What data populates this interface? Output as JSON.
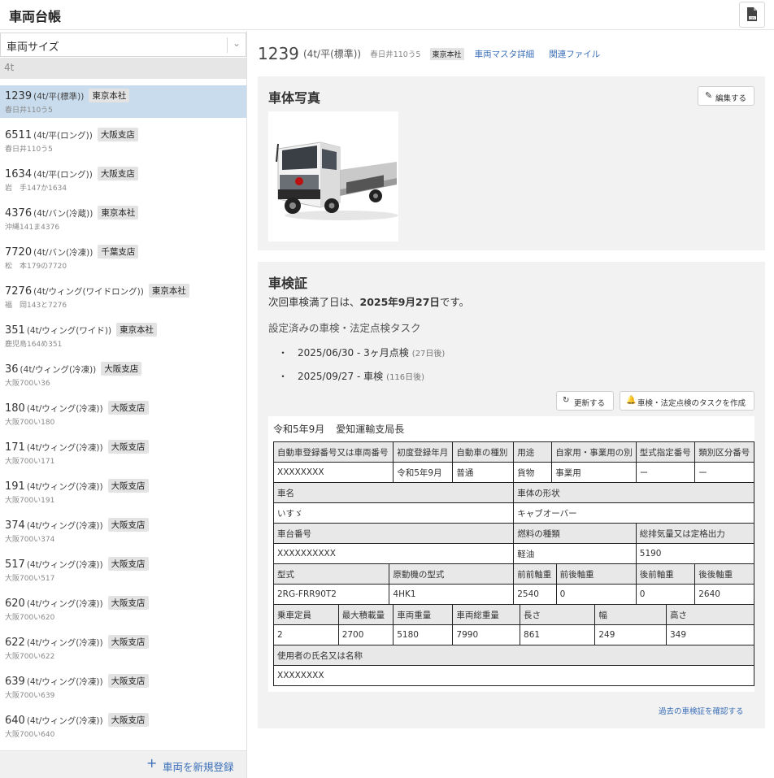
{
  "app": {
    "title": "車両台帳"
  },
  "sidebar": {
    "size_select": "車両サイズ",
    "filter": "4t",
    "add_label": "車両を新規登録",
    "vehicles": [
      {
        "num": "1239",
        "size": "(4t/平(標準))",
        "branch": "東京本社",
        "plate": "春日井110う5",
        "selected": true
      },
      {
        "num": "6511",
        "size": "(4t/平(ロング))",
        "branch": "大阪支店",
        "plate": "春日井110う5"
      },
      {
        "num": "1634",
        "size": "(4t/平(ロング))",
        "branch": "大阪支店",
        "plate": "岩　手147か1634"
      },
      {
        "num": "4376",
        "size": "(4t/バン(冷蔵))",
        "branch": "東京本社",
        "plate": "沖縄141ま4376"
      },
      {
        "num": "7720",
        "size": "(4t/バン(冷凍))",
        "branch": "千葉支店",
        "plate": "松　本179の7720"
      },
      {
        "num": "7276",
        "size": "(4t/ウィング(ワイドロング))",
        "branch": "東京本社",
        "plate": "福　岡143と7276"
      },
      {
        "num": "351",
        "size": "(4t/ウィング(ワイド))",
        "branch": "東京本社",
        "plate": "鹿児島164め351"
      },
      {
        "num": "36",
        "size": "(4t/ウィング(冷凍))",
        "branch": "大阪支店",
        "plate": "大阪700い36"
      },
      {
        "num": "180",
        "size": "(4t/ウィング(冷凍))",
        "branch": "大阪支店",
        "plate": "大阪700い180"
      },
      {
        "num": "171",
        "size": "(4t/ウィング(冷凍))",
        "branch": "大阪支店",
        "plate": "大阪700い171"
      },
      {
        "num": "191",
        "size": "(4t/ウィング(冷凍))",
        "branch": "大阪支店",
        "plate": "大阪700い191"
      },
      {
        "num": "374",
        "size": "(4t/ウィング(冷凍))",
        "branch": "大阪支店",
        "plate": "大阪700い374"
      },
      {
        "num": "517",
        "size": "(4t/ウィング(冷凍))",
        "branch": "大阪支店",
        "plate": "大阪700い517"
      },
      {
        "num": "620",
        "size": "(4t/ウィング(冷凍))",
        "branch": "大阪支店",
        "plate": "大阪700い620"
      },
      {
        "num": "622",
        "size": "(4t/ウィング(冷凍))",
        "branch": "大阪支店",
        "plate": "大阪700い622"
      },
      {
        "num": "639",
        "size": "(4t/ウィング(冷凍))",
        "branch": "大阪支店",
        "plate": "大阪700い639"
      },
      {
        "num": "640",
        "size": "(4t/ウィング(冷凍))",
        "branch": "大阪支店",
        "plate": "大阪700い640"
      }
    ]
  },
  "detail": {
    "num": "1239",
    "size": "(4t/平(標準))",
    "plate": "春日井110う5",
    "branch": "東京本社",
    "master_link": "車両マスタ詳細",
    "files_link": "関連ファイル",
    "photo": {
      "title": "車体写真",
      "edit_label": "編集する"
    },
    "shaken": {
      "title": "車検証",
      "due_prefix": "次回車検満了日は、",
      "due_date": "2025年9月27日",
      "due_suffix": "です。",
      "tasks_heading": "設定済みの車検・法定点検タスク",
      "tasks": [
        {
          "date": "2025/06/30",
          "name": "3ヶ月点検",
          "rel": "(27日後)"
        },
        {
          "date": "2025/09/27",
          "name": "車検",
          "rel": "(116日後)"
        }
      ],
      "refresh_label": "更新する",
      "create_label": "車検・法定点検のタスクを作成",
      "past_link": "過去の車検証を確認する",
      "cert": {
        "issue_date": "令和5年9月",
        "issuer": "愛知運輸支局長",
        "r1_h": [
          "自動車登録番号又は車両番号",
          "初度登録年月",
          "自動車の種別",
          "用途",
          "自家用・事業用の別",
          "型式指定番号",
          "類別区分番号"
        ],
        "r1_v": [
          "XXXXXXXX",
          "令和5年9月",
          "普通",
          "貨物",
          "事業用",
          "ー",
          "ー"
        ],
        "r2_h": [
          "車名",
          "車体の形状"
        ],
        "r2_v": [
          "いすゞ",
          "キャブオーバー"
        ],
        "r3_h": [
          "車台番号",
          "燃料の種類",
          "総排気量又は定格出力"
        ],
        "r3_v": [
          "XXXXXXXXXX",
          "軽油",
          "5190"
        ],
        "r4_h": [
          "型式",
          "原動機の型式",
          "前前軸重",
          "前後軸重",
          "後前軸重",
          "後後軸重"
        ],
        "r4_v": [
          "2RG-FRR90T2",
          "4HK1",
          "2540",
          "0",
          "0",
          "2640"
        ],
        "r5_h": [
          "乗車定員",
          "最大積載量",
          "車両重量",
          "車両総重量",
          "長さ",
          "幅",
          "高さ"
        ],
        "r5_v": [
          "2",
          "2700",
          "5180",
          "7990",
          "861",
          "249",
          "349"
        ],
        "r6_h": [
          "使用者の氏名又は名称"
        ],
        "r6_v": [
          "XXXXXXXX"
        ]
      }
    }
  },
  "colors": {
    "accent": "#3a6fb8",
    "selected_row": "#c8dced",
    "card_bg": "#f2f2f2"
  }
}
